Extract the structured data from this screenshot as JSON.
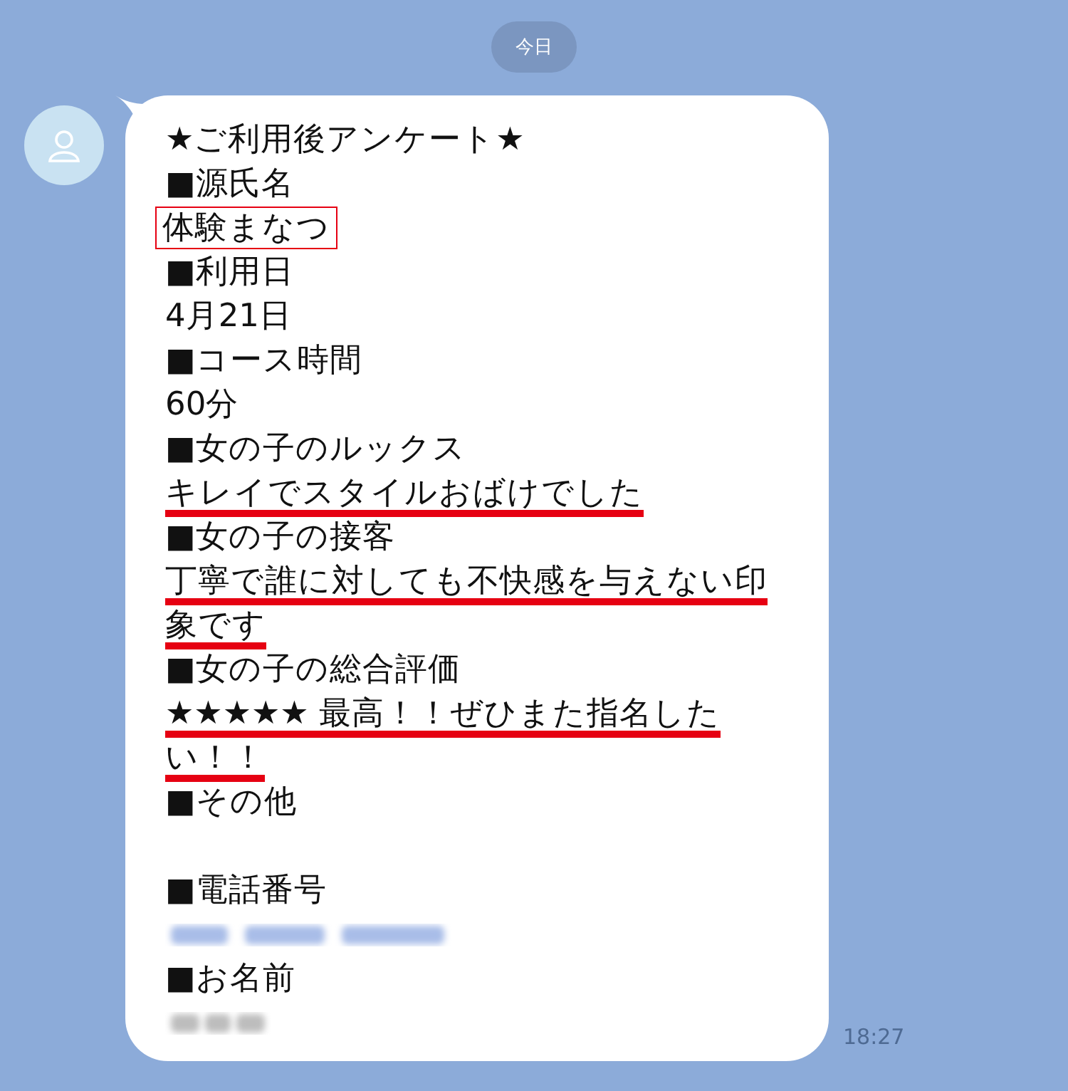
{
  "date_divider": "今日",
  "message": {
    "time": "18:27",
    "lines": [
      {
        "kind": "text",
        "text": "★ご利用後アンケート★",
        "boxed": false,
        "underlined": false
      },
      {
        "kind": "text",
        "text": "■源氏名",
        "boxed": false,
        "underlined": false
      },
      {
        "kind": "text",
        "text": "体験まなつ",
        "boxed": true,
        "underlined": false
      },
      {
        "kind": "text",
        "text": "■利用日",
        "boxed": false,
        "underlined": false
      },
      {
        "kind": "text",
        "text": "4月21日",
        "boxed": false,
        "underlined": false
      },
      {
        "kind": "text",
        "text": "■コース時間",
        "boxed": false,
        "underlined": false
      },
      {
        "kind": "text",
        "text": "60分",
        "boxed": false,
        "underlined": false
      },
      {
        "kind": "text",
        "text": "■女の子のルックス",
        "boxed": false,
        "underlined": false
      },
      {
        "kind": "text",
        "text": "キレイでスタイルおばけでした",
        "boxed": false,
        "underlined": true
      },
      {
        "kind": "text",
        "text": "■女の子の接客",
        "boxed": false,
        "underlined": false
      },
      {
        "kind": "text",
        "text": "丁寧で誰に対しても不快感を与えない印",
        "boxed": false,
        "underlined": true
      },
      {
        "kind": "text",
        "text": "象です",
        "boxed": false,
        "underlined": true
      },
      {
        "kind": "text",
        "text": "■女の子の総合評価",
        "boxed": false,
        "underlined": false
      },
      {
        "kind": "text",
        "text": "★★★★★ 最高！！ぜひまた指名した",
        "boxed": false,
        "underlined": true
      },
      {
        "kind": "text",
        "text": "い！！",
        "boxed": false,
        "underlined": true
      },
      {
        "kind": "text",
        "text": "■その他",
        "boxed": false,
        "underlined": false
      },
      {
        "kind": "blank"
      },
      {
        "kind": "text",
        "text": "■電話番号",
        "boxed": false,
        "underlined": false
      },
      {
        "kind": "blurred-link"
      },
      {
        "kind": "text",
        "text": "■お名前",
        "boxed": false,
        "underlined": false
      },
      {
        "kind": "blurred-text"
      }
    ]
  }
}
